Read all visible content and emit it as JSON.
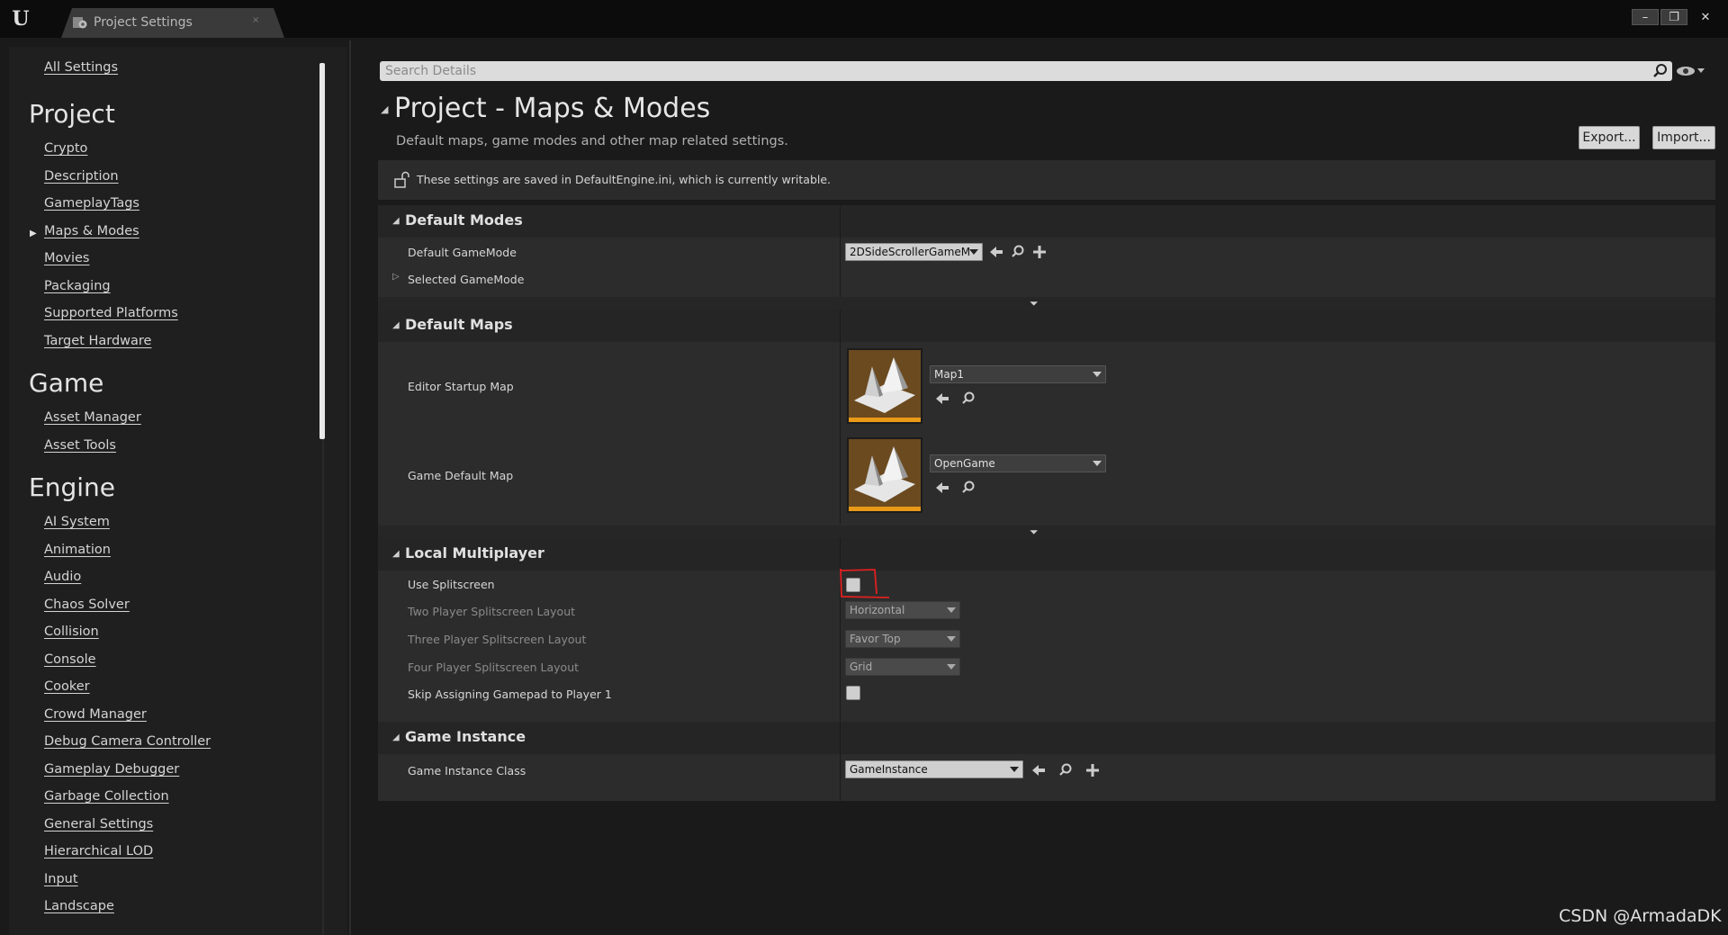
{
  "window": {
    "tab_label": "Project Settings",
    "tab_close": "×",
    "minimize": "–",
    "restore": "❐",
    "close": "✕"
  },
  "sidebar": {
    "all_settings": "All Settings",
    "project_heading": "Project",
    "project_items": [
      "Crypto",
      "Description",
      "GameplayTags",
      "Maps & Modes",
      "Movies",
      "Packaging",
      "Supported Platforms",
      "Target Hardware"
    ],
    "game_heading": "Game",
    "game_items": [
      "Asset Manager",
      "Asset Tools"
    ],
    "engine_heading": "Engine",
    "engine_items": [
      "AI System",
      "Animation",
      "Audio",
      "Chaos Solver",
      "Collision",
      "Console",
      "Cooker",
      "Crowd Manager",
      "Debug Camera Controller",
      "Gameplay Debugger",
      "Garbage Collection",
      "General Settings",
      "Hierarchical LOD",
      "Input",
      "Landscape"
    ]
  },
  "search": {
    "placeholder": "Search Details"
  },
  "page": {
    "title": "Project - Maps & Modes",
    "subtitle": "Default maps, game modes and other map related settings.",
    "export_label": "Export...",
    "import_label": "Import...",
    "notice": "These settings are saved in DefaultEngine.ini, which is currently writable."
  },
  "default_modes": {
    "header": "Default Modes",
    "game_mode_label": "Default GameMode",
    "game_mode_value": "2DSideScrollerGameM",
    "selected_game_mode_label": "Selected GameMode"
  },
  "default_maps": {
    "header": "Default Maps",
    "editor_startup_label": "Editor Startup Map",
    "editor_startup_value": "Map1",
    "game_default_label": "Game Default Map",
    "game_default_value": "OpenGame"
  },
  "local_multiplayer": {
    "header": "Local Multiplayer",
    "use_splitscreen_label": "Use Splitscreen",
    "two_player_label": "Two Player Splitscreen Layout",
    "two_player_value": "Horizontal",
    "three_player_label": "Three Player Splitscreen Layout",
    "three_player_value": "Favor Top",
    "four_player_label": "Four Player Splitscreen Layout",
    "four_player_value": "Grid",
    "skip_gamepad_label": "Skip Assigning Gamepad to Player 1"
  },
  "game_instance": {
    "header": "Game Instance",
    "class_label": "Game Instance Class",
    "class_value": "GameInstance"
  },
  "watermark": "CSDN @ArmadaDK",
  "colors": {
    "accent_orange": "#e89a18",
    "annotation_red": "#e02020",
    "panel": "#2c2c2c",
    "background": "#1a1a1a"
  }
}
